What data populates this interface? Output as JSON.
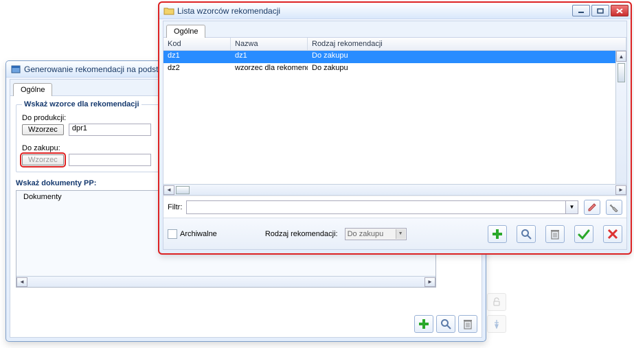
{
  "window_gen": {
    "title": "Generowanie rekomendacji na podsta",
    "tabs": {
      "items": [
        "Ogólne"
      ]
    },
    "fieldset_wzorce": {
      "legend": "Wskaż wzorce dla rekomendacji",
      "do_produkcji": {
        "label": "Do produkcji:",
        "button": "Wzorzec",
        "value": "dpr1"
      },
      "do_zakupu": {
        "label": "Do zakupu:",
        "button": "Wzorzec",
        "value": ""
      }
    },
    "doc_label": "Wskaż dokumenty PP:",
    "doc_header": "Dokumenty"
  },
  "window_list": {
    "title": "Lista wzorców rekomendacji",
    "tabs": {
      "items": [
        "Ogólne"
      ]
    },
    "columns": {
      "kod": "Kod",
      "nazwa": "Nazwa",
      "rodzaj": "Rodzaj rekomendacji"
    },
    "rows": [
      {
        "kod": "dz1",
        "nazwa": "dz1",
        "rodzaj": "Do zakupu",
        "selected": true
      },
      {
        "kod": "dz2",
        "nazwa": "wzorzec dla rekomendac",
        "rodzaj": "Do zakupu",
        "selected": false
      }
    ],
    "filter_label": "Filtr:",
    "archive_label": "Archiwalne",
    "recom_label": "Rodzaj rekomendacji:",
    "recom_value": "Do zakupu"
  }
}
